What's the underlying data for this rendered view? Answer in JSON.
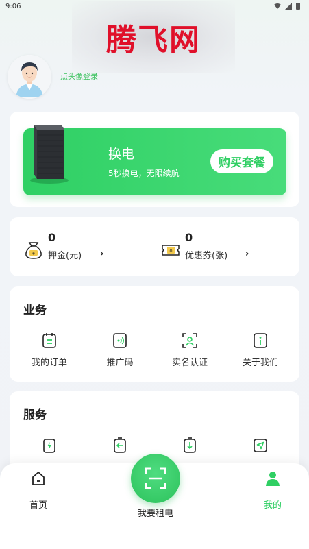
{
  "status_bar": {
    "time": "9:06"
  },
  "watermark": {
    "text": "腾飞网"
  },
  "profile": {
    "login_text": "点头像登录"
  },
  "banner": {
    "title": "换电",
    "subtitle": "5秒换电，无限续航",
    "button_label": "购买套餐"
  },
  "wallet": {
    "deposit": {
      "value": "0",
      "label": "押金(元)"
    },
    "coupon": {
      "value": "0",
      "label": "优惠券(张)"
    },
    "arrow": "›"
  },
  "business": {
    "title": "业务",
    "items": [
      {
        "label": "我的订单",
        "icon": "order-list-icon"
      },
      {
        "label": "推广码",
        "icon": "promo-code-icon"
      },
      {
        "label": "实名认证",
        "icon": "id-verify-icon"
      },
      {
        "label": "关于我们",
        "icon": "info-icon"
      }
    ]
  },
  "service": {
    "title": "服务",
    "items": [
      {
        "label": "",
        "icon": "battery-charge-icon"
      },
      {
        "label": "",
        "icon": "return-battery-icon"
      },
      {
        "label": "",
        "icon": "battery-cabinet-icon"
      },
      {
        "label": "",
        "icon": "navigate-icon"
      }
    ]
  },
  "nav": {
    "home_label": "首页",
    "rent_label": "我要租电",
    "mine_label": "我的"
  },
  "colors": {
    "accent": "#2fcf63",
    "watermark": "#e0102a"
  }
}
